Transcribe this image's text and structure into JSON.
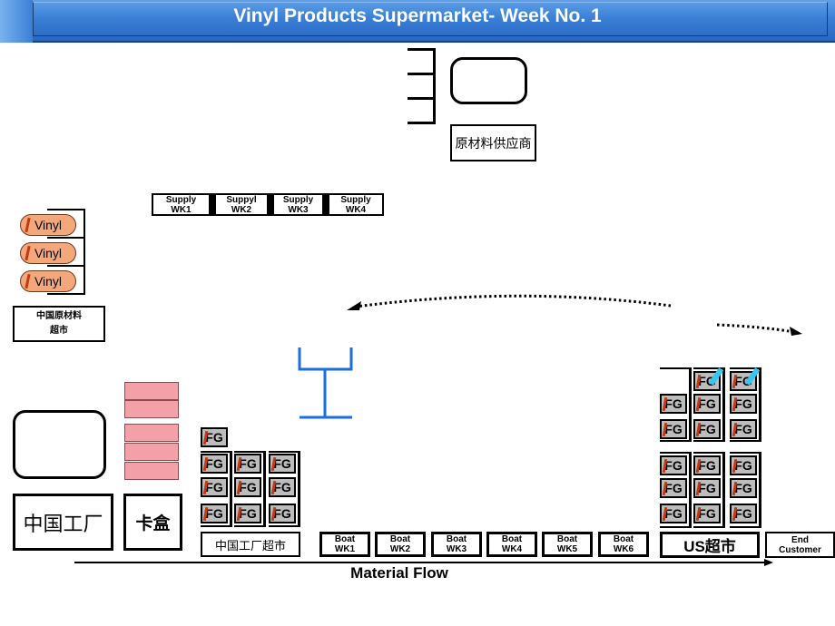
{
  "header": {
    "title": "Vinyl Products Supermarket- Week No. 1"
  },
  "supplier": {
    "label": "原材料供应商"
  },
  "supply_weeks": [
    "Supply\nWK1",
    "Suppyl\nWK2",
    "Supply\nWK3",
    "Supply\nWK4"
  ],
  "supply_weeks_line1": [
    "Supply",
    "Suppyl",
    "Supply",
    "Supply"
  ],
  "supply_weeks_line2": [
    "WK1",
    "WK2",
    "WK3",
    "WK4"
  ],
  "vinyl_market": {
    "items": [
      "Vinyl",
      "Vinyl",
      "Vinyl"
    ],
    "label_line1": "中国原材料",
    "label_line2": "超市"
  },
  "china_factory": {
    "label": "中国工厂"
  },
  "kanban": {
    "label": "卡盒"
  },
  "china_supermarket": {
    "label": "中国工厂超市",
    "fg_label": "FG"
  },
  "boats": {
    "line1": [
      "Boat",
      "Boat",
      "Boat",
      "Boat",
      "Boat",
      "Boat"
    ],
    "line2": [
      "WK1",
      "WK2",
      "WK3",
      "WK4",
      "WK5",
      "WK6"
    ]
  },
  "us_supermarket": {
    "label": "US超市",
    "fg_label": "FG"
  },
  "end_customer": {
    "line1": "End",
    "line2": "Customer"
  },
  "material_flow": {
    "label": "Material Flow"
  },
  "colors": {
    "banner": "#3a7fd6",
    "vinyl": "#f4a77a",
    "fg": "#bdbdbd",
    "kanban_card": "#f4a0a8",
    "stripe": "#c43a10",
    "tag": "#33c8f2",
    "post": "#1a6ee0"
  }
}
